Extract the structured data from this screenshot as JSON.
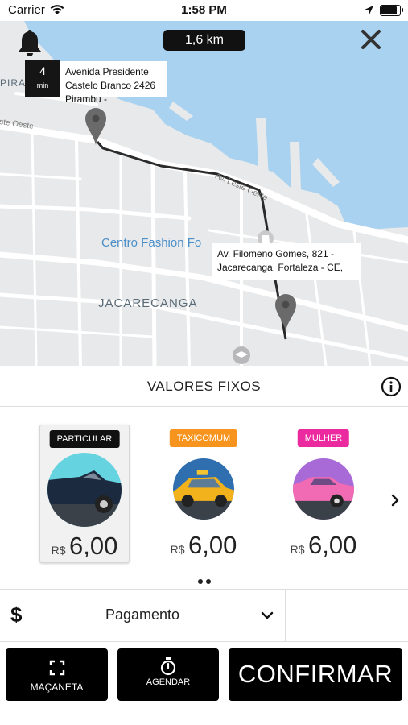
{
  "status_bar": {
    "carrier": "Carrier",
    "time": "1:58 PM"
  },
  "map": {
    "distance": "1,6 km",
    "eta": {
      "value": "4",
      "unit": "min"
    },
    "origin_address": "Avenida Presidente Castelo Branco 2426 Pirambu -",
    "destination_address": "Av. Filomeno Gomes, 821 - Jacarecanga, Fortaleza - CE,",
    "labels": {
      "street_1": "Av. Leste Oeste",
      "street_2": "ste Oeste",
      "poi": "Centro Fashion Fo",
      "district": "JACARECANGA",
      "district_2": "PIRA"
    }
  },
  "section": {
    "title": "VALORES FIXOS"
  },
  "vehicles": [
    {
      "badge": "PARTICULAR",
      "badge_color": "#111111",
      "currency": "R$",
      "price": "6,00",
      "selected": true
    },
    {
      "badge": "TAXICOMUM",
      "badge_color": "#f7941d",
      "currency": "R$",
      "price": "6,00",
      "selected": false
    },
    {
      "badge": "MULHER",
      "badge_color": "#ec2aa0",
      "currency": "R$",
      "price": "6,00",
      "selected": false
    }
  ],
  "payment": {
    "symbol": "$",
    "label": "Pagamento"
  },
  "buttons": {
    "macaneta": "MAÇANETA",
    "agendar": "AGENDAR",
    "confirmar": "CONFIRMAR"
  },
  "colors": {
    "water": "#a9d2f1",
    "route": "#222222",
    "accent_taxi": "#f7941d",
    "accent_mulher": "#ec2aa0"
  }
}
